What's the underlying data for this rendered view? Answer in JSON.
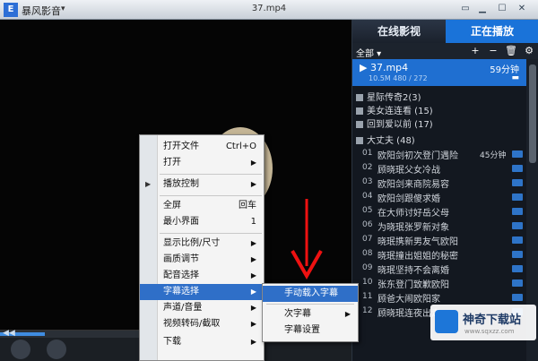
{
  "app": {
    "name": "暴风影音",
    "menu_arrow": "▾",
    "logo_glyph": "E",
    "window_title": "37.mp4",
    "window_buttons": [
      "▭",
      "▁",
      "☐",
      "✕"
    ]
  },
  "panel": {
    "tabs": [
      "在线影视",
      "正在播放"
    ],
    "active_tab": "正在播放",
    "filter_label": "全部 ▾",
    "tools": [
      "+",
      "−",
      "🗑",
      "⚙"
    ],
    "current": {
      "name": "▶ 37.mp4",
      "duration": "59分钟",
      "meta": "10.5M    480 / 272",
      "folder_icon": "▬"
    },
    "groups": [
      {
        "label": "星际传奇2(3)"
      },
      {
        "label": "美女连连看 (15)"
      },
      {
        "label": "回到爱以前 (17)"
      },
      {
        "label": "大丈夫 (48)"
      }
    ],
    "episodes": [
      {
        "num": "01",
        "title": "欧阳剑初次登门遇险",
        "dur": "45分钟"
      },
      {
        "num": "02",
        "title": "顾晓珉父女冷战",
        "dur": ""
      },
      {
        "num": "03",
        "title": "欧阳剑来商院易容",
        "dur": ""
      },
      {
        "num": "04",
        "title": "欧阳剑跟傻求婚",
        "dur": ""
      },
      {
        "num": "05",
        "title": "在大师讨好岳父母",
        "dur": ""
      },
      {
        "num": "06",
        "title": "为晓珉张罗新对象",
        "dur": ""
      },
      {
        "num": "07",
        "title": "晓珉携新男友气欧阳",
        "dur": ""
      },
      {
        "num": "08",
        "title": "晓珉撞出姐姐的秘密",
        "dur": ""
      },
      {
        "num": "09",
        "title": "晓珉坚持不会离婚",
        "dur": ""
      },
      {
        "num": "10",
        "title": "张东登门致歉欧阳",
        "dur": ""
      },
      {
        "num": "11",
        "title": "顾爸大闹欧阳家",
        "dur": ""
      },
      {
        "num": "12",
        "title": "顾晓珉连夜出走",
        "dur": ""
      }
    ]
  },
  "context_menu": {
    "items": [
      {
        "label": "打开文件",
        "shortcut": "Ctrl+O",
        "arrow": "",
        "check": ""
      },
      {
        "label": "打开",
        "shortcut": "",
        "arrow": "▶",
        "check": ""
      },
      {
        "label": "播放控制",
        "shortcut": "",
        "arrow": "▶",
        "check": "▶"
      },
      {
        "label": "全屏",
        "shortcut": "回车",
        "arrow": "",
        "check": ""
      },
      {
        "label": "最小界面",
        "shortcut": "1",
        "arrow": "",
        "check": ""
      },
      {
        "label": "显示比例/尺寸",
        "shortcut": "",
        "arrow": "▶",
        "check": ""
      },
      {
        "label": "画质调节",
        "shortcut": "",
        "arrow": "▶",
        "check": ""
      },
      {
        "label": "配音选择",
        "shortcut": "",
        "arrow": "▶",
        "check": ""
      },
      {
        "label": "字幕选择",
        "shortcut": "",
        "arrow": "▶",
        "check": ""
      },
      {
        "label": "声道/音量",
        "shortcut": "",
        "arrow": "▶",
        "check": ""
      },
      {
        "label": "视频转码/截取",
        "shortcut": "",
        "arrow": "▶",
        "check": ""
      },
      {
        "label": "下载",
        "shortcut": "",
        "arrow": "▶",
        "check": ""
      }
    ],
    "highlighted": "字幕选择"
  },
  "subtitle_menu": {
    "items": [
      {
        "label": "手动载入字幕",
        "arrow": ""
      },
      {
        "label": "次字幕",
        "arrow": "▶"
      },
      {
        "label": "字幕设置",
        "arrow": ""
      }
    ],
    "highlighted": "手动载入字幕"
  },
  "bottombar": {
    "seek_arrow": "◀◀"
  },
  "watermark": {
    "text": "神奇下载站",
    "url": "www.sqxzz.com"
  }
}
